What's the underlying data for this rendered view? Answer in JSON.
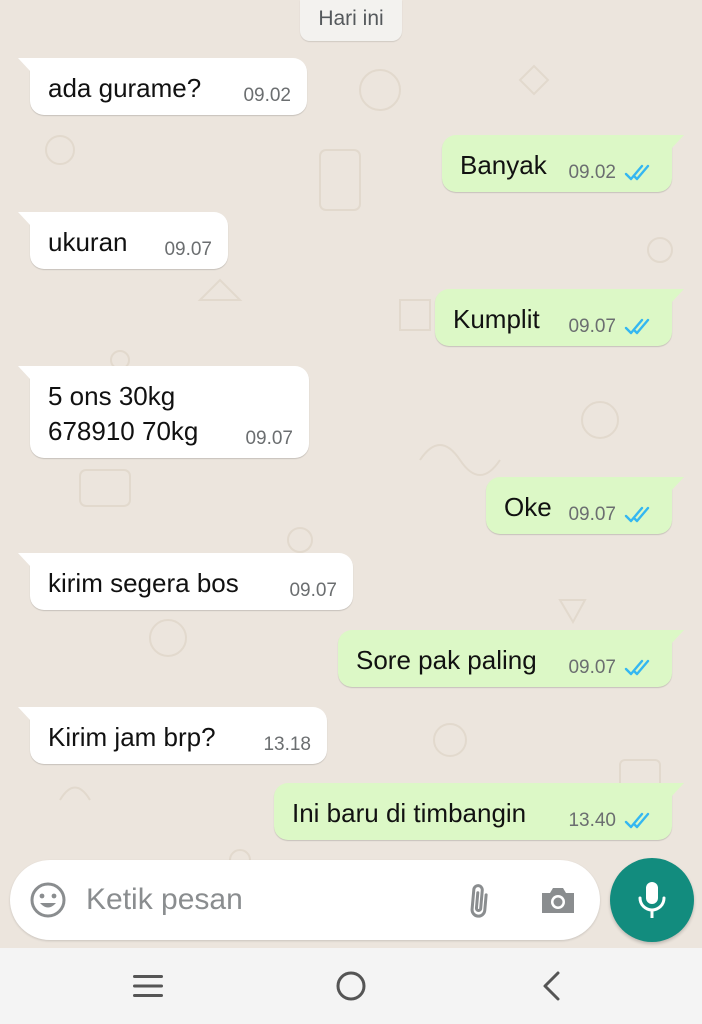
{
  "chat": {
    "date_label": "Hari ini",
    "messages": [
      {
        "direction": "in",
        "text": "ada gurame?",
        "time": "09.02"
      },
      {
        "direction": "out",
        "text": "Banyak",
        "time": "09.02",
        "status": "read"
      },
      {
        "direction": "in",
        "text": "ukuran",
        "time": "09.07"
      },
      {
        "direction": "out",
        "text": "Kumplit",
        "time": "09.07",
        "status": "read"
      },
      {
        "direction": "in",
        "lines": [
          "5 ons 30kg",
          "678910 70kg"
        ],
        "time": "09.07"
      },
      {
        "direction": "out",
        "text": "Oke",
        "time": "09.07",
        "status": "read"
      },
      {
        "direction": "in",
        "text": "kirim segera bos",
        "time": "09.07"
      },
      {
        "direction": "out",
        "text": "Sore pak paling",
        "time": "09.07",
        "status": "read"
      },
      {
        "direction": "in",
        "text": "Kirim jam brp?",
        "time": "13.18"
      },
      {
        "direction": "out",
        "text": "Ini baru di timbangin",
        "time": "13.40",
        "status": "read"
      }
    ]
  },
  "input_bar": {
    "placeholder": "Ketik pesan",
    "value": "",
    "icons": [
      "emoji-icon",
      "paperclip-icon",
      "camera-icon"
    ]
  },
  "mic_button": {
    "icon": "microphone-icon"
  },
  "nav_bar": {
    "icons": [
      "recent-apps-icon",
      "home-icon",
      "back-icon"
    ]
  },
  "colors": {
    "chat_background": "#ece5dd",
    "incoming_bubble": "#ffffff",
    "outgoing_bubble": "#dcf8c6",
    "read_ticks": "#34b7f1",
    "accent": "#128c7e"
  }
}
